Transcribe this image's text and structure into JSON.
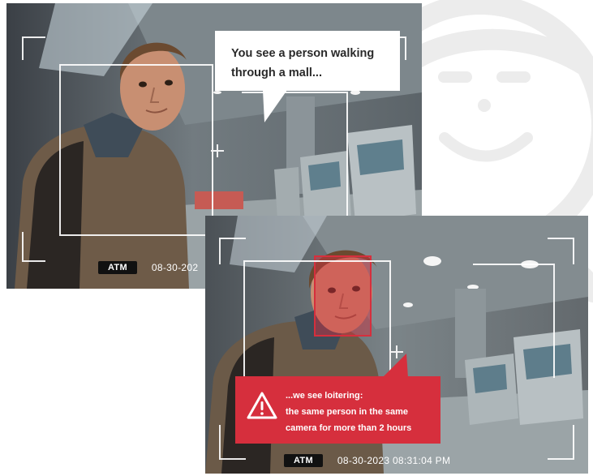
{
  "frames": {
    "first": {
      "speech_line_1": "You see a person walking",
      "speech_line_2": "through a mall...",
      "badge": "ATM",
      "timestamp": "08-30-202"
    },
    "second": {
      "alert_line_1": "...we see loitering:",
      "alert_line_2": "the same person in the same",
      "alert_line_3": "camera for more than 2 hours",
      "badge": "ATM",
      "timestamp": "08-30-2023 08:31:04 PM"
    }
  },
  "colors": {
    "alert_red": "#d62f3d",
    "bubble_white": "#ffffff",
    "osd_text": "#ffffff",
    "badge_bg": "#111111"
  },
  "icons": [
    "person-avatar-icon",
    "warning-triangle-icon"
  ]
}
